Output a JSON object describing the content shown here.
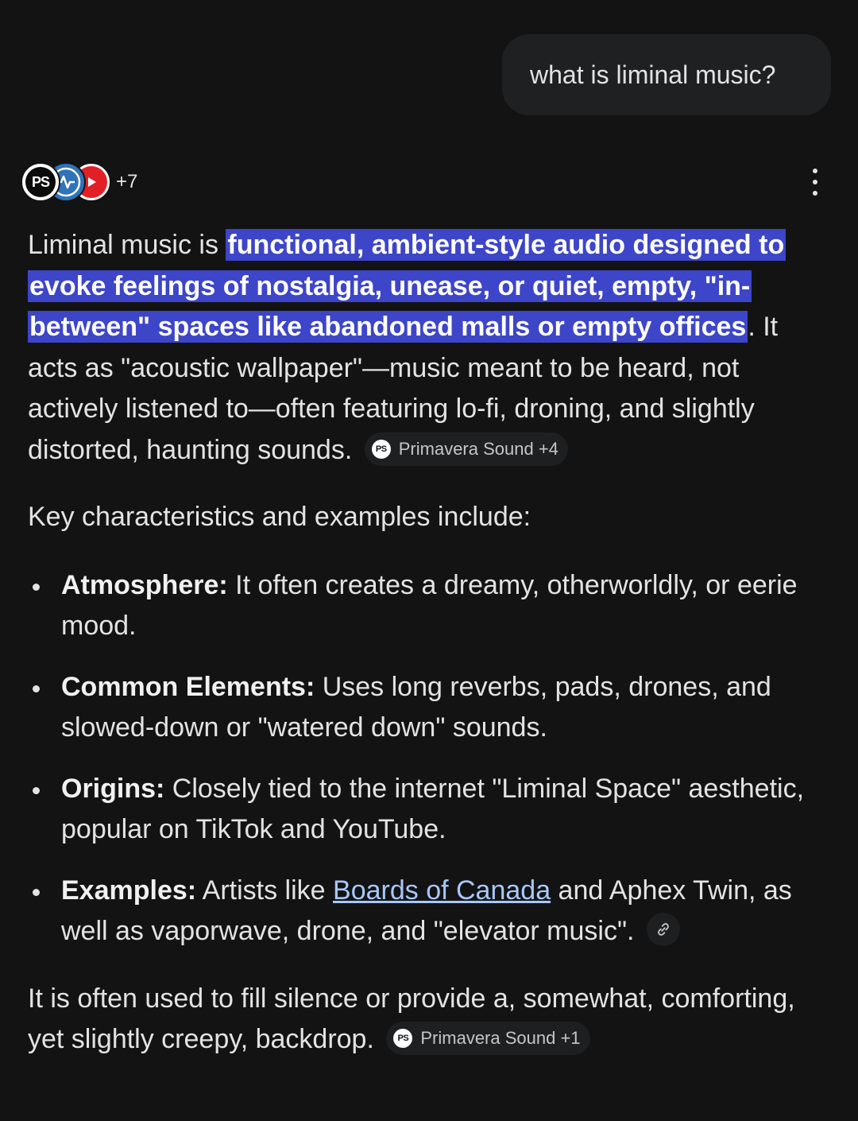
{
  "query": {
    "text": "what is liminal music?"
  },
  "sources": {
    "logo_ps": "PS",
    "more_count": "+7"
  },
  "answer": {
    "intro_lead": "Liminal music is ",
    "intro_highlight": "functional, ambient-style audio designed to evoke feelings of nostalgia, unease, or quiet, empty, \"in-between\" spaces like abandoned malls or empty offices",
    "intro_tail": ". It acts as \"acoustic wallpaper\"—music meant to be heard, not actively listened to—often featuring lo-fi, droning, and slightly distorted, haunting sounds.",
    "intro_citation": "Primavera Sound +4",
    "key_heading": "Key characteristics and examples include:",
    "bullets": [
      {
        "term": "Atmosphere:",
        "text": " It often creates a dreamy, otherworldly, or eerie mood."
      },
      {
        "term": "Common Elements:",
        "text": " Uses long reverbs, pads, drones, and slowed-down or \"watered down\" sounds."
      },
      {
        "term": "Origins:",
        "text": " Closely tied to the internet \"Liminal Space\" aesthetic, popular on TikTok and YouTube."
      },
      {
        "term": "Examples:",
        "text_before": " Artists like ",
        "link": "Boards of Canada",
        "text_after": " and Aphex Twin, as well as vaporwave, drone, and \"elevator music\"."
      }
    ],
    "closing": "It is often used to fill silence or provide a, somewhat, comforting, yet slightly creepy, backdrop.",
    "closing_citation": "Primavera Sound +1",
    "citation_logo": "PS"
  },
  "colors": {
    "background": "#131314",
    "highlight": "#3d45c9",
    "link": "#a8c7fa",
    "bubble": "#1f2022"
  },
  "icons": [
    "primavera-sound-logo",
    "blue-source-logo",
    "youtube-logo",
    "more-vert-icon",
    "link-icon"
  ]
}
